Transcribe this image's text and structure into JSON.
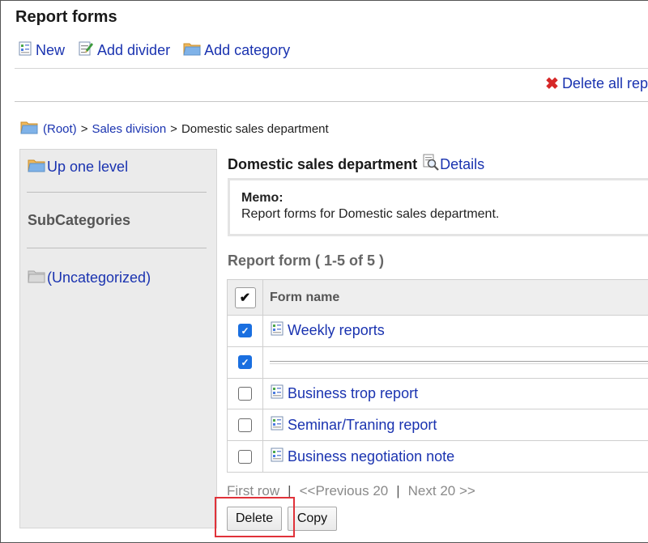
{
  "page": {
    "title": "Report forms"
  },
  "toolbar": {
    "new_label": "New",
    "add_divider_label": "Add divider",
    "add_category_label": "Add category"
  },
  "delete_all_label": "Delete all rep",
  "breadcrumb": {
    "root": "(Root)",
    "sep1": ">",
    "level1": "Sales division",
    "sep2": ">",
    "current": "Domestic sales department"
  },
  "sidebar": {
    "up_label": "Up one level",
    "subcategories_title": "SubCategories",
    "uncategorized_label": "(Uncategorized)"
  },
  "main": {
    "category_name": "Domestic sales department",
    "details_label": "Details",
    "memo_title": "Memo:",
    "memo_text": "Report forms for Domestic sales department.",
    "count_text": "Report form ( 1-5 of 5 )"
  },
  "table": {
    "header": {
      "checkall": "✔",
      "form_name": "Form name"
    },
    "rows": [
      {
        "name": "Weekly reports",
        "checked": true,
        "kind": "form"
      },
      {
        "name": "",
        "checked": true,
        "kind": "divider"
      },
      {
        "name": "Business trop report",
        "checked": false,
        "kind": "form"
      },
      {
        "name": "Seminar/Traning report",
        "checked": false,
        "kind": "form"
      },
      {
        "name": "Business negotiation note",
        "checked": false,
        "kind": "form"
      }
    ]
  },
  "pager": {
    "first": "First row",
    "sep": "|",
    "prev": "<<Previous 20",
    "next": "Next 20 >>"
  },
  "buttons": {
    "delete": "Delete",
    "copy": "Copy"
  },
  "colors": {
    "link": "#1a33b0",
    "checkbox_on": "#1a6fe0",
    "highlight": "#e0323a",
    "delete_x": "#d62828"
  },
  "icons": [
    "form-icon",
    "add-divider-icon",
    "folder-icon",
    "delete-x-icon",
    "details-magnifier-icon",
    "folder-gray-icon"
  ]
}
